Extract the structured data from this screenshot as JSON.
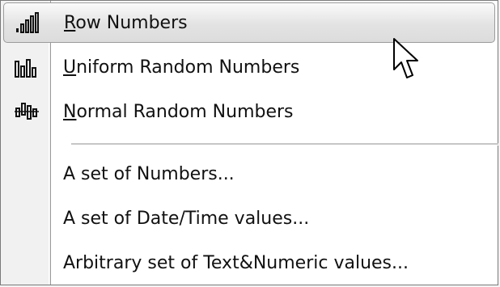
{
  "menu": {
    "items": [
      {
        "label_key": "R",
        "label_rest": "ow Numbers",
        "icon": "bar-chart-ascending-icon",
        "selected": true
      },
      {
        "label_key": "U",
        "label_rest": "niform Random Numbers",
        "icon": "bar-chart-random-icon",
        "selected": false
      },
      {
        "label_key": "N",
        "label_rest": "ormal Random Numbers",
        "icon": "bar-chart-normal-icon",
        "selected": false
      },
      {
        "label": "A set of Numbers..."
      },
      {
        "label": "A set of Date/Time values..."
      },
      {
        "label": "Arbitrary set of Text&Numeric values..."
      }
    ]
  },
  "colors": {
    "gutter": "#f1f1f1",
    "highlight_border": "#9b9b9b",
    "text": "#111111"
  }
}
